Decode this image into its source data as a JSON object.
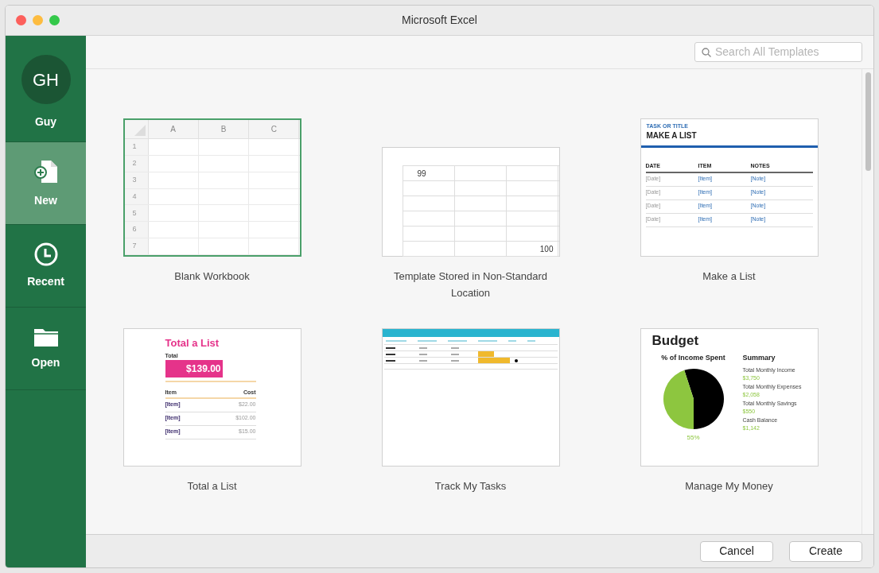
{
  "window": {
    "title": "Microsoft Excel"
  },
  "sidebar": {
    "account": {
      "initials": "GH",
      "name": "Guy"
    },
    "items": [
      {
        "label": "New",
        "kind": "new",
        "selected": true
      },
      {
        "label": "Recent",
        "kind": "recent",
        "selected": false
      },
      {
        "label": "Open",
        "kind": "open",
        "selected": false
      }
    ]
  },
  "search": {
    "placeholder": "Search All Templates"
  },
  "templates": [
    {
      "kind": "blank",
      "title": "Blank Workbook",
      "selected": true,
      "columns": [
        "A",
        "B",
        "C"
      ],
      "rows": [
        "1",
        "2",
        "3",
        "4",
        "5",
        "6",
        "7"
      ]
    },
    {
      "kind": "grid",
      "title": "Template Stored in Non-Standard Location",
      "selected": false,
      "first_value": "99",
      "last_value": "100"
    },
    {
      "kind": "list",
      "title": "Make a List",
      "selected": false,
      "heading": "TASK OR TITLE",
      "name": "MAKE A LIST",
      "columns": [
        "DATE",
        "ITEM",
        "NOTES"
      ],
      "rows": [
        [
          "[Date]",
          "[Item]",
          "[Note]"
        ],
        [
          "[Date]",
          "[Item]",
          "[Note]"
        ],
        [
          "[Date]",
          "[Item]",
          "[Note]"
        ],
        [
          "[Date]",
          "[Item]",
          "[Note]"
        ]
      ]
    },
    {
      "kind": "total",
      "title": "Total a List",
      "selected": false,
      "heading": "Total a List",
      "total_label": "Total",
      "total": "$139.00",
      "columns": [
        "Item",
        "Cost"
      ],
      "rows": [
        [
          "[Item]",
          "$22.00"
        ],
        [
          "[Item]",
          "$102.00"
        ],
        [
          "[Item]",
          "$15.00"
        ]
      ]
    },
    {
      "kind": "tasks",
      "title": "Track My Tasks",
      "selected": false,
      "rows": [
        {
          "done": false
        },
        {
          "done": false
        },
        {
          "done": true
        }
      ]
    },
    {
      "kind": "budget",
      "title": "Manage My Money",
      "selected": false,
      "heading": "Budget",
      "summary_title": "Summary",
      "summary": [
        {
          "label": "Total Monthly Income",
          "value": "$3,750"
        },
        {
          "label": "Total Monthly Expenses",
          "value": "$2,058"
        },
        {
          "label": "Total Monthly Savings",
          "value": "$550"
        },
        {
          "label": "Cash Balance",
          "value": "$1,142"
        }
      ],
      "chart_data": {
        "type": "pie",
        "title": "% of Income Spent",
        "values": [
          55,
          45
        ],
        "colors": [
          "#000000",
          "#8dc63f"
        ],
        "annotations": [
          {
            "text": "55%"
          }
        ]
      }
    }
  ],
  "buttons": [
    {
      "label": "Cancel"
    },
    {
      "label": "Create"
    }
  ]
}
